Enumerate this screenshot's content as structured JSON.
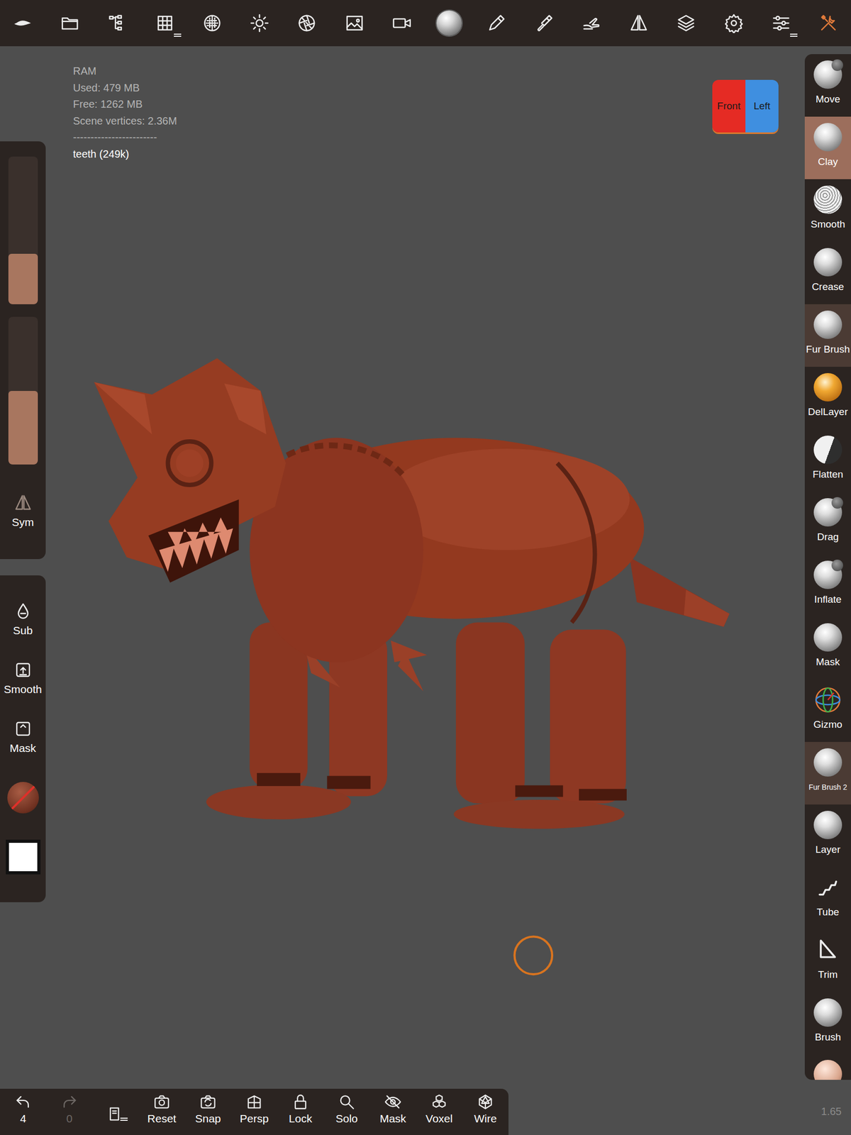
{
  "topbar": [
    {
      "selected": false
    },
    {
      "selected": false
    },
    {
      "selected": false
    },
    {
      "selected": false
    },
    {
      "selected": false
    },
    {
      "selected": false
    },
    {
      "selected": false
    },
    {
      "selected": false
    },
    {
      "selected": false
    },
    {
      "selected": false
    },
    {
      "selected": false
    },
    {
      "selected": false
    },
    {
      "selected": false
    },
    {
      "selected": false
    },
    {
      "selected": false
    },
    {
      "selected": false
    },
    {
      "selected": false
    },
    {
      "selected": true
    }
  ],
  "stats": {
    "lines": [
      "RAM",
      "Used: 479 MB",
      "Free: 1262 MB",
      "Scene vertices: 2.36M",
      "------------------------"
    ],
    "selection": "teeth (249k)"
  },
  "view_cube": {
    "front": "Front",
    "left": "Left"
  },
  "tools": [
    {
      "label": "Move",
      "selected": false,
      "highlighted": false
    },
    {
      "label": "Clay",
      "selected": true,
      "highlighted": false
    },
    {
      "label": "Smooth",
      "selected": false,
      "highlighted": false
    },
    {
      "label": "Crease",
      "selected": false,
      "highlighted": false
    },
    {
      "label": "Fur Brush",
      "selected": false,
      "highlighted": true
    },
    {
      "label": "DelLayer",
      "selected": false,
      "highlighted": false
    },
    {
      "label": "Flatten",
      "selected": false,
      "highlighted": false
    },
    {
      "label": "Drag",
      "selected": false,
      "highlighted": false
    },
    {
      "label": "Inflate",
      "selected": false,
      "highlighted": false
    },
    {
      "label": "Mask",
      "selected": false,
      "highlighted": false
    },
    {
      "label": "Gizmo",
      "selected": false,
      "highlighted": false
    },
    {
      "label": "Fur Brush 2",
      "selected": false,
      "highlighted": true
    },
    {
      "label": "Layer",
      "selected": false,
      "highlighted": false
    },
    {
      "label": "Tube",
      "selected": false,
      "highlighted": false
    },
    {
      "label": "Trim",
      "selected": false,
      "highlighted": false
    },
    {
      "label": "Brush",
      "selected": false,
      "highlighted": false
    }
  ],
  "left_panel": {
    "sliders": [
      {
        "level": 0.34
      },
      {
        "level": 0.5
      }
    ],
    "sym": {
      "label": "Sym"
    },
    "buttons": [
      {
        "label": "Sub"
      },
      {
        "label": "Smooth"
      },
      {
        "label": "Mask"
      }
    ],
    "color": "#ffffff"
  },
  "bottom_bar": {
    "undo": {
      "count": "4",
      "disabled": false
    },
    "redo": {
      "count": "0",
      "disabled": true
    },
    "buttons": [
      "Reset",
      "Snap",
      "Persp",
      "Lock",
      "Solo",
      "Mask",
      "Voxel",
      "Wire"
    ]
  },
  "version": "1.65"
}
